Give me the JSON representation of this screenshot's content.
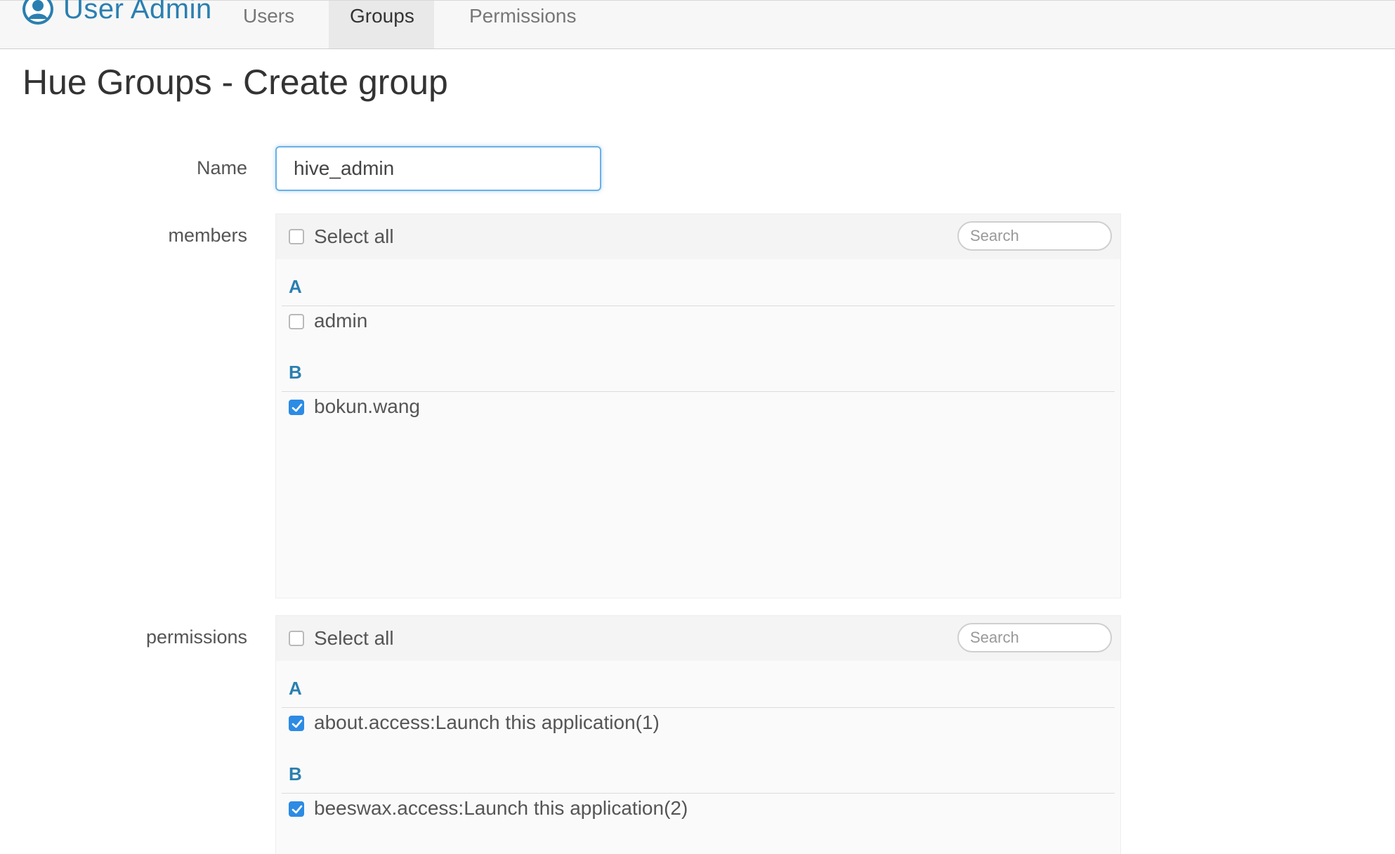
{
  "app": {
    "title": "User Admin",
    "brand_color": "#2a7fb0",
    "icon": "user-circle-icon"
  },
  "nav": {
    "tabs": [
      {
        "label": "Users",
        "active": false
      },
      {
        "label": "Groups",
        "active": true
      },
      {
        "label": "Permissions",
        "active": false
      }
    ]
  },
  "page": {
    "title": "Hue Groups - Create group"
  },
  "form": {
    "name_label": "Name",
    "name_value": "hive_admin",
    "members": {
      "label": "members",
      "select_all_label": "Select all",
      "select_all_checked": false,
      "search_placeholder": "Search",
      "groups": [
        {
          "letter": "A",
          "items": [
            {
              "label": "admin",
              "checked": false
            }
          ]
        },
        {
          "letter": "B",
          "items": [
            {
              "label": "bokun.wang",
              "checked": true
            }
          ]
        }
      ]
    },
    "permissions": {
      "label": "permissions",
      "select_all_label": "Select all",
      "select_all_checked": false,
      "search_placeholder": "Search",
      "groups": [
        {
          "letter": "A",
          "items": [
            {
              "label": "about.access:Launch this application(1)",
              "checked": true
            }
          ]
        },
        {
          "letter": "B",
          "items": [
            {
              "label": "beeswax.access:Launch this application(2)",
              "checked": true
            }
          ]
        }
      ]
    }
  },
  "colors": {
    "checkbox_checked": "#2c8be4",
    "input_focus": "#6ab0e6"
  }
}
